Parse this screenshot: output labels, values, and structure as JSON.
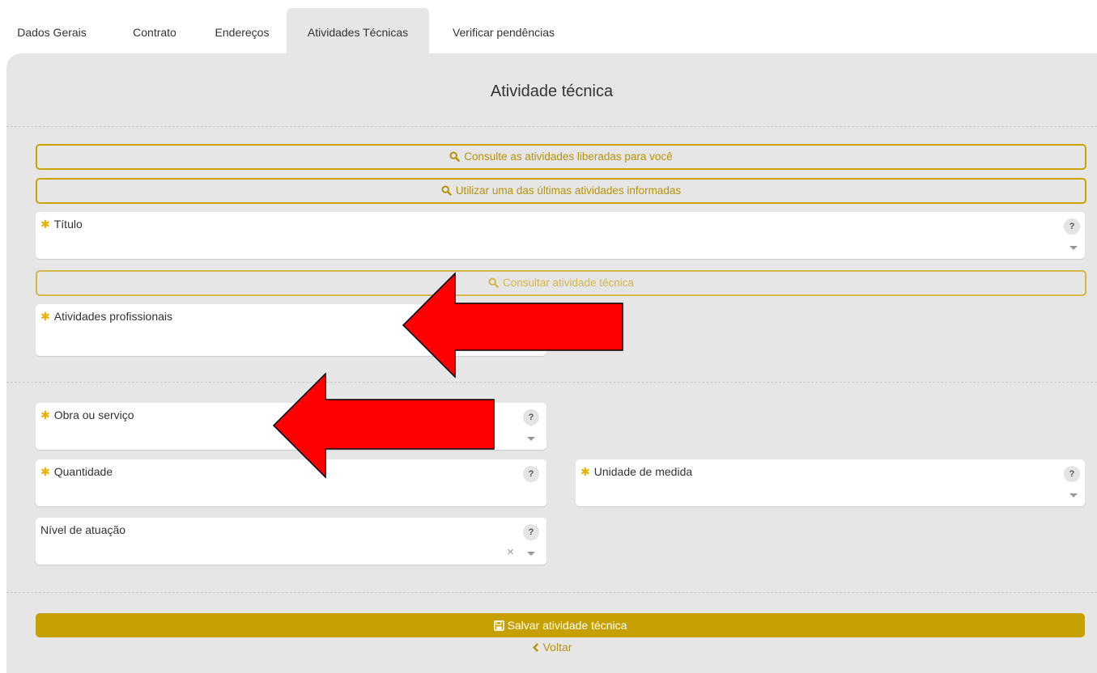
{
  "tabs": [
    {
      "label": "Dados Gerais"
    },
    {
      "label": "Contrato"
    },
    {
      "label": "Endereços"
    },
    {
      "label": "Atividades Técnicas"
    },
    {
      "label": "Verificar pendências"
    }
  ],
  "active_tab": "Atividades Técnicas",
  "panel": {
    "title": "Atividade técnica",
    "consult_released_label": "Consulte as atividades liberadas para você",
    "use_last_label": "Utilizar uma das últimas atividades informadas",
    "consult_technical_label": "Consultar atividade técnica",
    "save_label": "Salvar atividade técnica",
    "back_label": "Voltar"
  },
  "fields": {
    "titulo": {
      "label": "Título",
      "required": true
    },
    "atividades_profissionais": {
      "label": "Atividades profissionais",
      "required": true
    },
    "obra_servico": {
      "label": "Obra ou serviço",
      "required": true
    },
    "quantidade": {
      "label": "Quantidade",
      "required": true
    },
    "unidade_medida": {
      "label": "Unidade de medida",
      "required": true
    },
    "nivel_atuacao": {
      "label": "Nível de atuação",
      "required": false
    }
  },
  "help_glyph": "?",
  "required_glyph": "✱",
  "clear_glyph": "×",
  "colors": {
    "accent": "#c5a000",
    "accent_text": "#b5930a",
    "panel_bg": "#e6e6e6",
    "required_star": "#e8b100",
    "annotation_arrow": "#ff0000"
  },
  "icons": [
    "search-icon",
    "save-icon",
    "chevron-left-icon",
    "help-icon",
    "caret-down-icon",
    "clear-icon"
  ]
}
